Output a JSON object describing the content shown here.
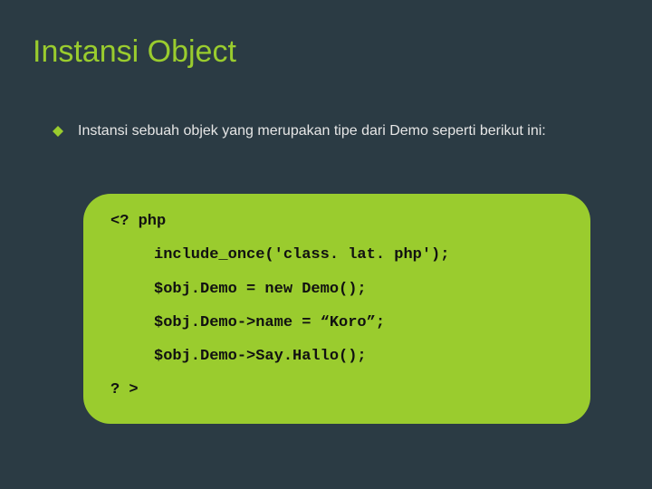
{
  "title": "Instansi Object",
  "bullet": "Instansi sebuah objek yang merupakan tipe dari Demo seperti berikut ini:",
  "code": {
    "open": "<? php",
    "line1": "include_once('class. lat. php');",
    "line2": "$obj.Demo = new Demo();",
    "line3": "$obj.Demo->name = “Koro”;",
    "line4": "$obj.Demo->Say.Hallo();",
    "close": "? >"
  }
}
